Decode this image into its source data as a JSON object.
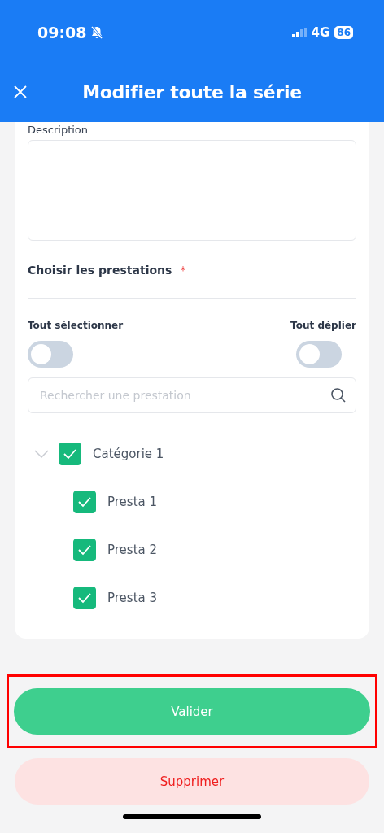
{
  "status_bar": {
    "time": "09:08",
    "network": "4G",
    "battery": "86",
    "silent": true
  },
  "header": {
    "title": "Modifier toute la série"
  },
  "description": {
    "label": "Description"
  },
  "services": {
    "label": "Choisir les prestations",
    "required_mark": "*"
  },
  "toggles": [
    {
      "label": "Tout sélectionner",
      "on": false
    },
    {
      "label": "Tout déplier",
      "on": false
    }
  ],
  "search": {
    "placeholder": "Rechercher une prestation"
  },
  "tree": [
    {
      "label": "Catégorie 1",
      "checked": true,
      "expanded": true,
      "children": [
        {
          "label": "Presta 1",
          "checked": true
        },
        {
          "label": "Presta 2",
          "checked": true
        },
        {
          "label": "Presta 3",
          "checked": true
        }
      ]
    }
  ],
  "buttons": [
    {
      "label": "Valider",
      "kind": "primary",
      "highlighted": true
    },
    {
      "label": "Supprimer",
      "kind": "danger",
      "highlighted": false
    }
  ]
}
